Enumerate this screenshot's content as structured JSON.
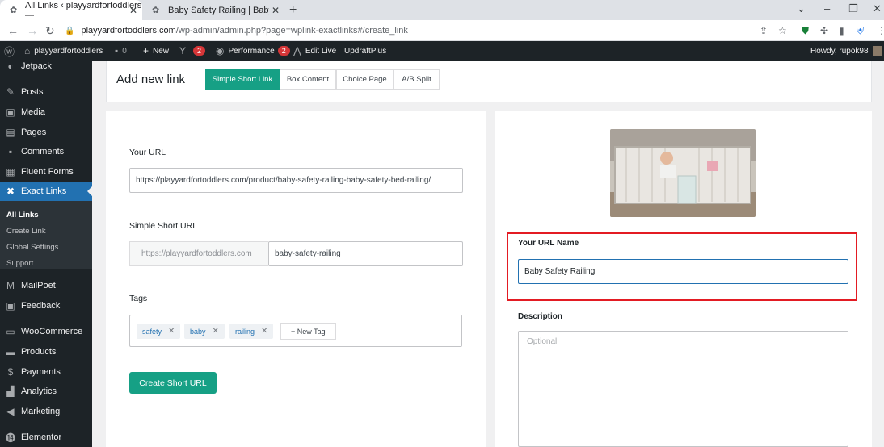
{
  "browser": {
    "tabs": [
      {
        "title": "All Links ‹ playyardfortoddlers —"
      },
      {
        "title": "Baby Safety Railing | Baby Safety"
      }
    ],
    "url_host": "playyardfortoddlers.com",
    "url_path": "/wp-admin/admin.php?page=wplink-exactlinks#/create_link"
  },
  "adminbar": {
    "site_name": "playyardfortoddlers",
    "comments_count": "0",
    "new_label": "New",
    "yoast_badge": "2",
    "performance_label": "Performance",
    "performance_badge": "2",
    "edit_live_label": "Edit Live",
    "updraft_label": "UpdraftPlus",
    "howdy": "Howdy, rupok98"
  },
  "sidebar": {
    "items": [
      {
        "label": "Jetpack",
        "icon": "jetpack-icon"
      },
      {
        "label": "Posts",
        "icon": "pin-icon"
      },
      {
        "label": "Media",
        "icon": "media-icon"
      },
      {
        "label": "Pages",
        "icon": "pages-icon"
      },
      {
        "label": "Comments",
        "icon": "comments-icon"
      },
      {
        "label": "Fluent Forms",
        "icon": "forms-icon"
      },
      {
        "label": "Exact Links",
        "icon": "exact-links-icon"
      },
      {
        "label": "MailPoet",
        "icon": "mailpoet-icon"
      },
      {
        "label": "Feedback",
        "icon": "feedback-icon"
      },
      {
        "label": "WooCommerce",
        "icon": "woocommerce-icon"
      },
      {
        "label": "Products",
        "icon": "products-icon"
      },
      {
        "label": "Payments",
        "icon": "payments-icon"
      },
      {
        "label": "Analytics",
        "icon": "analytics-icon"
      },
      {
        "label": "Marketing",
        "icon": "marketing-icon"
      },
      {
        "label": "Elementor",
        "icon": "elementor-icon"
      }
    ],
    "submenu": [
      "All Links",
      "Create Link",
      "Global Settings",
      "Support"
    ]
  },
  "main": {
    "title": "Add new link",
    "tabs": [
      "Simple Short Link",
      "Box Content",
      "Choice Page",
      "A/B Split"
    ],
    "your_url_label": "Your URL",
    "your_url_value": "https://playyardfortoddlers.com/product/baby-safety-railing-baby-safety-bed-railing/",
    "short_url_label": "Simple Short URL",
    "short_url_prefix": "https://playyardfortoddlers.com",
    "short_url_slug": "baby-safety-railing",
    "tags_label": "Tags",
    "tags": [
      "safety",
      "baby",
      "railing"
    ],
    "new_tag_label": "+ New Tag",
    "create_button": "Create Short URL",
    "url_name_label": "Your URL Name",
    "url_name_value": "Baby Safety Railing",
    "description_label": "Description",
    "description_placeholder": "Optional"
  },
  "colors": {
    "accent": "#16a085",
    "highlight": "#e31b23",
    "wp_blue": "#2271b1"
  }
}
